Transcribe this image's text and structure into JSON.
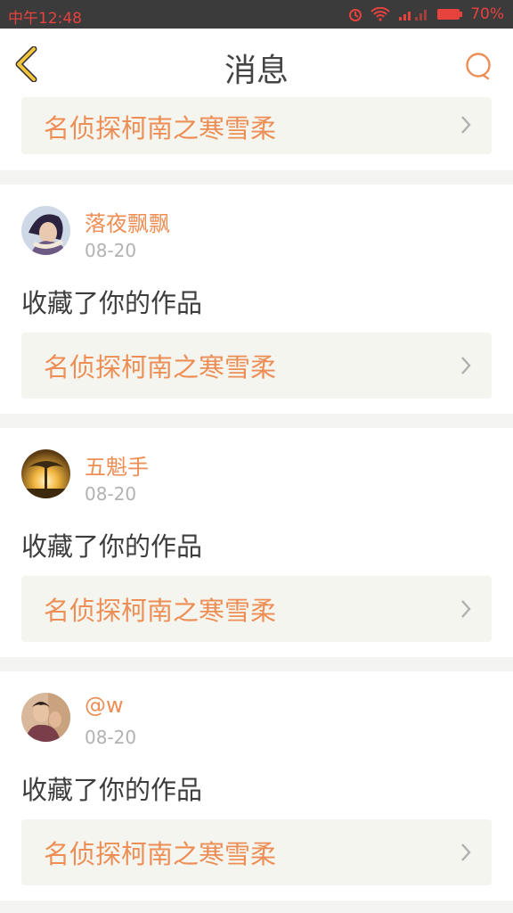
{
  "status_bar": {
    "time": "中午12:48",
    "battery": "70%",
    "color": "#e8423f"
  },
  "header": {
    "title": "消息"
  },
  "colors": {
    "accent": "#ec8e55",
    "back_icon": "#f2c53d",
    "work_bg": "#f5f5ef"
  },
  "items": [
    {
      "work_title": "名侦探柯南之寒雪柔"
    },
    {
      "user": "落夜飘飘",
      "date": "08-20",
      "action": "收藏了你的作品",
      "work_title": "名侦探柯南之寒雪柔"
    },
    {
      "user": "五魁手",
      "date": "08-20",
      "action": "收藏了你的作品",
      "work_title": "名侦探柯南之寒雪柔"
    },
    {
      "user": "@w",
      "date": "08-20",
      "action": "收藏了你的作品",
      "work_title": "名侦探柯南之寒雪柔"
    }
  ]
}
